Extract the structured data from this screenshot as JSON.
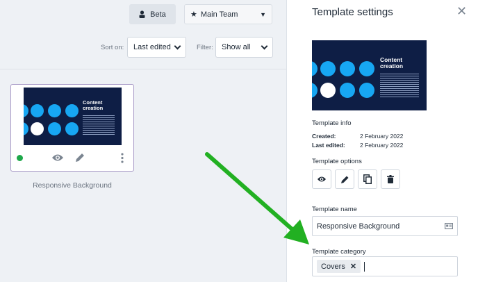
{
  "header": {
    "beta_label": "Beta",
    "team_label": "Main Team"
  },
  "sort": {
    "label": "Sort on:",
    "value": "Last edited"
  },
  "filter": {
    "label": "Filter:",
    "value": "Show all"
  },
  "card": {
    "title": "Responsive Background",
    "thumb_heading": "Content creation",
    "status_color": "#1ea84a"
  },
  "panel": {
    "title": "Template settings",
    "preview_heading": "Content creation",
    "info": {
      "heading": "Template info",
      "created_label": "Created:",
      "created_value": "2 February 2022",
      "edited_label": "Last edited:",
      "edited_value": "2 February 2022"
    },
    "options_heading": "Template options",
    "name": {
      "label": "Template name",
      "value": "Responsive Background"
    },
    "category": {
      "label": "Template category",
      "chip": "Covers"
    }
  },
  "colors": {
    "accent_blue": "#17a7f3",
    "navy": "#0e1e45",
    "arrow_green": "#22b022"
  }
}
